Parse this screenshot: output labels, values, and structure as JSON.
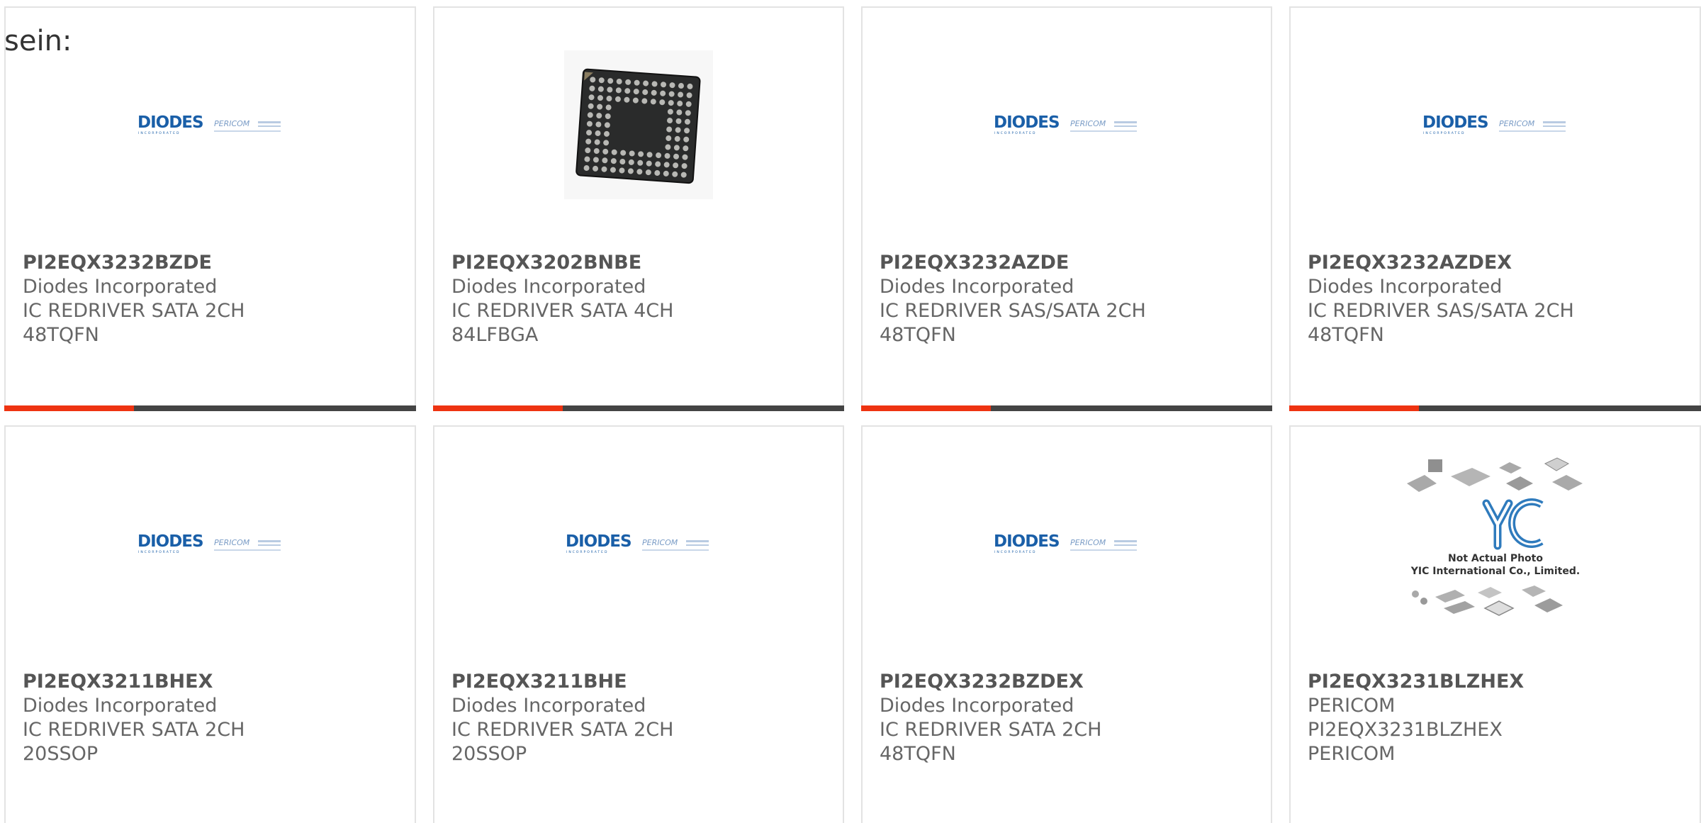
{
  "intro_text": "sein:",
  "colors": {
    "accent": "#ee3311",
    "bar_dark": "#444444",
    "logo_blue": "#1a5fa8",
    "border": "#e3e3e3"
  },
  "products": [
    {
      "part_number": "PI2EQX3232BZDE",
      "manufacturer": "Diodes Incorporated",
      "description": "IC REDRIVER SATA 2CH 48TQFN",
      "image": "diodes-pericom-logo"
    },
    {
      "part_number": "PI2EQX3202BNBE",
      "manufacturer": "Diodes Incorporated",
      "description": "IC REDRIVER SATA 4CH 84LFBGA",
      "image": "bga-chip-photo"
    },
    {
      "part_number": "PI2EQX3232AZDE",
      "manufacturer": "Diodes Incorporated",
      "description": "IC REDRIVER SAS/SATA 2CH 48TQFN",
      "image": "diodes-pericom-logo"
    },
    {
      "part_number": "PI2EQX3232AZDEX",
      "manufacturer": "Diodes Incorporated",
      "description": "IC REDRIVER SAS/SATA 2CH 48TQFN",
      "image": "diodes-pericom-logo"
    },
    {
      "part_number": "PI2EQX3211BHEX",
      "manufacturer": "Diodes Incorporated",
      "description": "IC REDRIVER SATA 2CH 20SSOP",
      "image": "diodes-pericom-logo"
    },
    {
      "part_number": "PI2EQX3211BHE",
      "manufacturer": "Diodes Incorporated",
      "description": "IC REDRIVER SATA 2CH 20SSOP",
      "image": "diodes-pericom-logo"
    },
    {
      "part_number": "PI2EQX3232BZDEX",
      "manufacturer": "Diodes Incorporated",
      "description": "IC REDRIVER SATA 2CH 48TQFN",
      "image": "diodes-pericom-logo"
    },
    {
      "part_number": "PI2EQX3231BLZHEX",
      "manufacturer": "PERICOM",
      "description": "PI2EQX3231BLZHEX PERICOM",
      "image": "yic-placeholder-photo"
    }
  ],
  "logo": {
    "brand": "DIODES",
    "sub": "PERICOM",
    "tagline": "INCORPORATED"
  },
  "yic_placeholder": {
    "brand": "YIC",
    "line1": "Not Actual Photo",
    "line2": "YIC International Co., Limited."
  }
}
